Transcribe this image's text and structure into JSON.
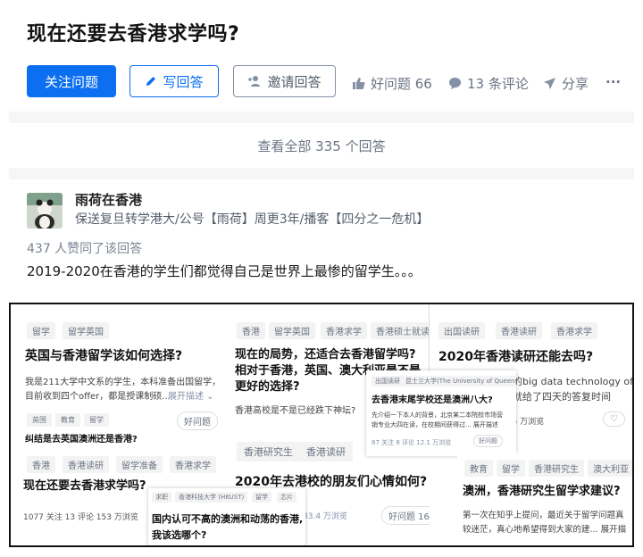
{
  "question": {
    "title": "现在还要去香港求学吗?"
  },
  "toolbar": {
    "follow_label": "关注问题",
    "write_label": "写回答",
    "invite_label": "邀请回答",
    "like_label": "好问题 66",
    "comment_label": "13 条评论",
    "share_label": "分享",
    "more_label": "···"
  },
  "view_all_label": "查看全部 335 个回答",
  "answer": {
    "author": "雨荷在香港",
    "bio": "保送复旦转学港大/公号【雨荷】周更3年/播客【四分之一危机】",
    "voters": "437 人赞同了该回答",
    "text": "2019-2020在香港的学生们都觉得自己是世界上最惨的留学生。。。"
  },
  "collage": {
    "card1": {
      "tags": [
        "留学",
        "留学英国"
      ],
      "title": "英国与香港留学该如何选择?",
      "body1": "我是211大学中文系的学生，本科准备出国留学，",
      "body2": "目前收到四个offer，都是授课制硕...",
      "expand": "展开描述 ⌄",
      "tags2": [
        "英国",
        "教育",
        "留学"
      ],
      "like": "好问题",
      "title2": "纠结是去英国澳洲还是香港?"
    },
    "card2": {
      "tags": [
        "香港",
        "留学英国",
        "香港求学",
        "香港硕士就读"
      ],
      "title1": "现在的局势，还适合去香港留学吗?",
      "title2": "相对于香港，英国、澳大利亚是不是",
      "title3": "更好的选择?",
      "body": "香港高校是不是已经跌下神坛?",
      "tags2": [
        "香港研究生",
        "香港读研"
      ],
      "title4": "2020年去港校的朋友们心情如何?",
      "views": "83.4 万浏览",
      "like": "好问题 16"
    },
    "card3": {
      "tags": [
        "出国读研",
        "香港读研",
        "香港求学"
      ],
      "title": "2020年香港读研还能去吗?",
      "body1": "技的big data technology offe",
      "body2": "年就给了四天的答复时间",
      "views": "5.5 万浏览"
    },
    "card4": {
      "tags": [
        "出国读研",
        "昆士兰大学(The University of Queensland)"
      ],
      "title": "去香港末尾学校还是澳洲八大?",
      "body1": "先介绍一下本人的背景，北京某二本院校市场营",
      "body2": "销专业大四在读，在校期间获得过...  展开描述",
      "meta": "87 关注   8 评论   12.1 万浏览",
      "like": "好问题"
    },
    "card5": {
      "tags": [
        "香港",
        "香港读研",
        "留学准备",
        "香港求学"
      ],
      "title": "现在还要去香港求学吗?",
      "meta": "1077 关注   13 评论   153 万浏览"
    },
    "card6": {
      "tags": [
        "求职",
        "香港科技大学 (HKUST)",
        "留学",
        "芯片"
      ],
      "title1": "国内认可不高的澳洲和动荡的香港,",
      "title2": "我该选哪个?"
    },
    "card7": {
      "tags": [
        "教育",
        "留学",
        "香港研究生",
        "澳大利亚"
      ],
      "title": "澳洲，香港研究生留学求建议?",
      "body1": "第一次在知乎上提问，最近关于留学问题真",
      "body2": "较迷茫，真心地希望得到大家的建...  展开描"
    }
  },
  "colors": {
    "accent": "#0c6ff1",
    "muted": "#8590a6"
  },
  "icons": [
    "pencil-icon",
    "add-user-icon",
    "thumbs-up-icon",
    "comment-icon",
    "paper-plane-icon",
    "more-icon"
  ]
}
